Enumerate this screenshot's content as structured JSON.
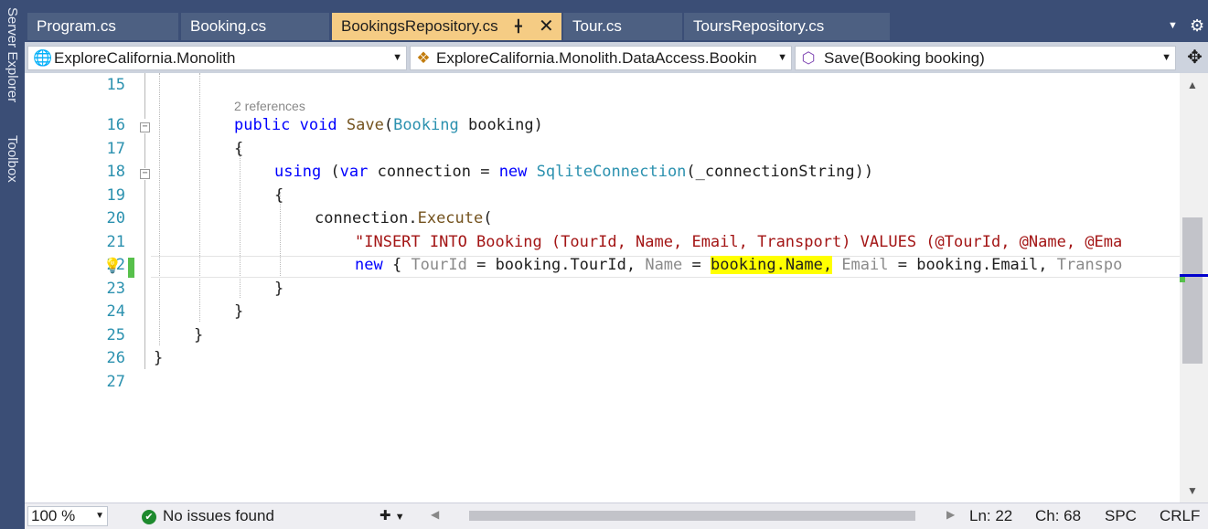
{
  "side_panels": [
    "Server Explorer",
    "Toolbox"
  ],
  "tabs": [
    {
      "label": "Program.cs",
      "active": false
    },
    {
      "label": "Booking.cs",
      "active": false
    },
    {
      "label": "BookingsRepository.cs",
      "active": true
    },
    {
      "label": "Tour.cs",
      "active": false
    },
    {
      "label": "ToursRepository.cs",
      "active": false
    }
  ],
  "tab_icons": {
    "pin": "pin-icon",
    "close": "close-icon",
    "overflow": "chevron-down-icon",
    "settings": "gear-icon"
  },
  "nav": {
    "project": "ExploreCalifornia.Monolith",
    "type": "ExploreCalifornia.Monolith.DataAccess.Bookin",
    "member": "Save(Booking booking)"
  },
  "editor": {
    "line_numbers": [
      "15",
      "16",
      "17",
      "18",
      "19",
      "20",
      "21",
      "22",
      "23",
      "24",
      "25",
      "26",
      "27"
    ],
    "codelens": "2 references",
    "lines": {
      "l16": [
        "public",
        " ",
        "void",
        " ",
        "Save",
        "(",
        "Booking",
        " booking)"
      ],
      "l17": "{",
      "l18": [
        "using",
        " (",
        "var",
        " connection = ",
        "new",
        " ",
        "SqliteConnection",
        "(_connectionString))"
      ],
      "l19": "{",
      "l20": [
        "connection.",
        "Execute",
        "("
      ],
      "l21": "\"INSERT INTO Booking (TourId, Name, Email, Transport) VALUES (@TourId, @Name, @Ema",
      "l22": [
        "new",
        " { ",
        "TourId",
        " = booking.TourId, ",
        "Name",
        " = ",
        "booking.Name,",
        " ",
        "Email",
        " = booking.Email, ",
        "Transpo"
      ],
      "l23": "}",
      "l24": "}",
      "l25": "}",
      "l26": "}"
    }
  },
  "status": {
    "zoom": "100 %",
    "issues": "No issues found",
    "line": "Ln: 22",
    "col": "Ch: 68",
    "spacing": "SPC",
    "eol": "CRLF"
  },
  "colors": {
    "chrome_bg": "#3b4e76",
    "active_tab": "#f5cc84",
    "keyword": "#0000ff",
    "type": "#2b91af",
    "string": "#a31515",
    "highlight": "#ffff00"
  }
}
